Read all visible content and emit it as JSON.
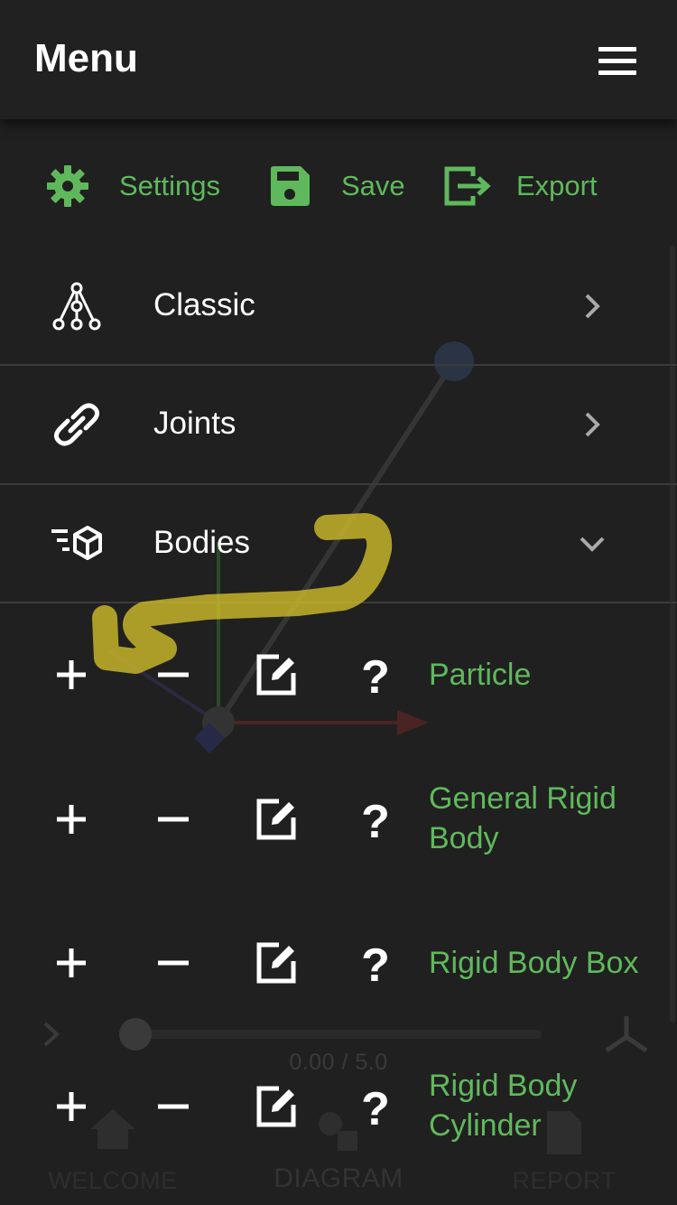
{
  "header": {
    "title": "Menu",
    "menu_icon": "hamburger-icon"
  },
  "toolbar": {
    "settings": {
      "label": "Settings",
      "icon": "gear-icon"
    },
    "save": {
      "label": "Save",
      "icon": "floppy-icon"
    },
    "export": {
      "label": "Export",
      "icon": "export-icon"
    }
  },
  "nav": [
    {
      "label": "Classic",
      "icon": "graph-tree-icon",
      "state": "collapsed"
    },
    {
      "label": "Joints",
      "icon": "link-icon",
      "state": "collapsed"
    },
    {
      "label": "Bodies",
      "icon": "cube-list-icon",
      "state": "expanded"
    }
  ],
  "bodies": [
    {
      "name": "Particle"
    },
    {
      "name": "General Rigid Body"
    },
    {
      "name": "Rigid Body Box"
    },
    {
      "name": "Rigid Body Cylinder"
    }
  ],
  "background": {
    "time_readout": "0.00 / 5.0",
    "tabs": [
      {
        "label": "WELCOME"
      },
      {
        "label": "DIAGRAM"
      },
      {
        "label": "REPORT"
      }
    ]
  },
  "colors": {
    "accent": "#5fb95c",
    "background": "#202020",
    "annotation": "#d4c02a"
  }
}
